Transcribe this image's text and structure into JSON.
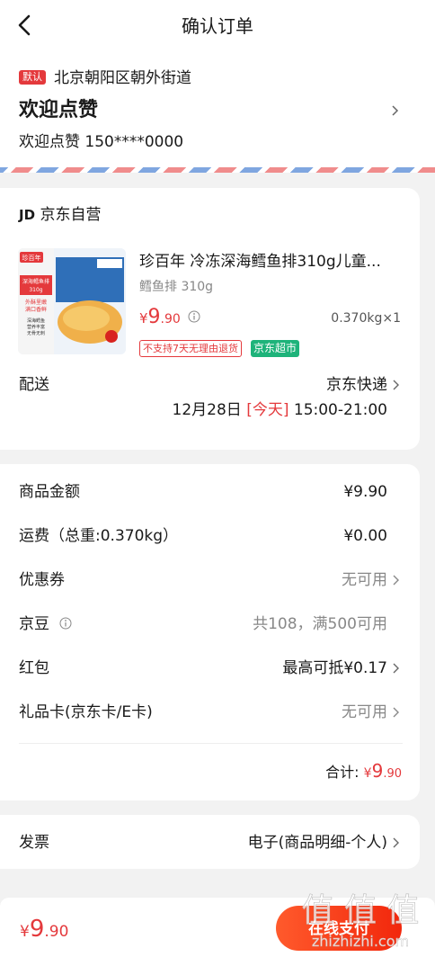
{
  "header": {
    "title": "确认订单"
  },
  "address": {
    "default_badge": "默认",
    "region": "北京朝阳区朝外街道",
    "name": "欢迎点赞",
    "contact": "欢迎点赞 150****0000"
  },
  "shop": {
    "logo_text": "JD",
    "name": "京东自营",
    "product": {
      "title": "珍百年 冷冻深海鳕鱼排310g儿童...",
      "spec": "鳕鱼排 310g",
      "price_currency": "¥",
      "price_int": "9",
      "price_dec": ".90",
      "qty": "0.370kg×1",
      "tag_return": "不支持7天无理由退货",
      "tag_market": "京东超市",
      "image_texts": [
        "珍百年",
        "深海鳕鱼排",
        "310g",
        "外酥里嫩",
        "满口香鲜",
        "深海鳕鱼",
        "营养丰富",
        "无骨无刺"
      ]
    },
    "delivery": {
      "label": "配送",
      "method": "京东快递",
      "date": "12月28日",
      "today": "[今天]",
      "window": "15:00-21:00"
    }
  },
  "amounts": {
    "rows": [
      {
        "label": "商品金额",
        "value": "¥9.90"
      },
      {
        "label": "运费（总重:0.370kg）",
        "value": "¥0.00"
      },
      {
        "label": "优惠券",
        "value": "无可用"
      },
      {
        "label": "京豆",
        "value": "共108，满500可用"
      },
      {
        "label": "红包",
        "value": "最高可抵¥0.17"
      },
      {
        "label": "礼品卡(京东卡/E卡)",
        "value": "无可用"
      }
    ],
    "total_label": "合计:",
    "total_currency": "¥",
    "total_int": "9",
    "total_dec": ".90"
  },
  "invoice": {
    "label": "发票",
    "value": "电子(商品明细-个人)"
  },
  "bottom": {
    "currency": "¥",
    "price_int": "9",
    "price_dec": ".90",
    "pay_label": "在线支付"
  },
  "watermark": {
    "text": "值 值 值",
    "url_text": "zhizhizhi.com"
  },
  "colors": {
    "accent": "#e4393c",
    "market_green": "#1eb37a",
    "pay_gradient_start": "#ff5a2c",
    "pay_gradient_end": "#f2270c"
  }
}
